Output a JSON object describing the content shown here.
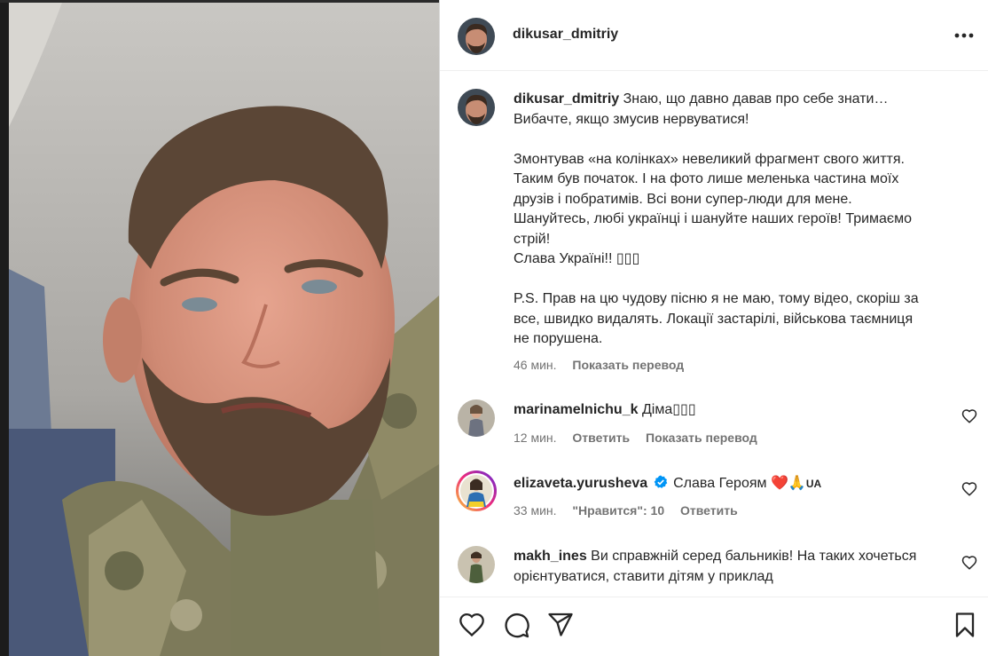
{
  "post": {
    "author": "dikusar_dmitriy",
    "caption_lines": [
      "Знаю, що давно давав про себе знати…",
      "Вибачте, якщо змусив нервуватися!",
      "",
      "Змонтував «на колінках» невеликий фрагмент свого життя.",
      "Таким був початок. І на фото лише меленька частина моїх",
      "друзів і побратимів. Всі вони супер-люди для мене.",
      "Шануйтесь, любі українці і шануйте наших героїв! Тримаємо",
      "стрій!",
      "Слава Україні!! ▯▯▯",
      "",
      "P.S. Прав на цю чудову пісню я не маю, тому відео, скоріш за",
      "все, швидко видалять. Локації застарілі, військова таємниця",
      "не порушена."
    ],
    "time": "46 мин.",
    "translate": "Показать перевод"
  },
  "comments": [
    {
      "user": "marinamelnichu_k",
      "text": "Діма▯▯▯",
      "time": "12 мин.",
      "reply": "Ответить",
      "translate": "Показать перевод"
    },
    {
      "user": "elizaveta.yurusheva",
      "verified": true,
      "text": "Слава Героям",
      "emojis": "❤️🙏",
      "flag_text": "UA",
      "time": "33 мин.",
      "likes": "\"Нравится\": 10",
      "reply": "Ответить"
    },
    {
      "user": "makh_ines",
      "text_line1": "Ви справжній серед бальників! На таких хочеться",
      "text_line2": "орієнтуватися, ставити дітям у приклад"
    }
  ],
  "colors": {
    "text": "#262626",
    "meta": "#737373",
    "verified": "#0095f6",
    "heart": "#e0245e"
  },
  "icons": [
    "more-icon",
    "heart-icon",
    "comment-icon",
    "share-icon",
    "save-icon",
    "verified-icon"
  ]
}
